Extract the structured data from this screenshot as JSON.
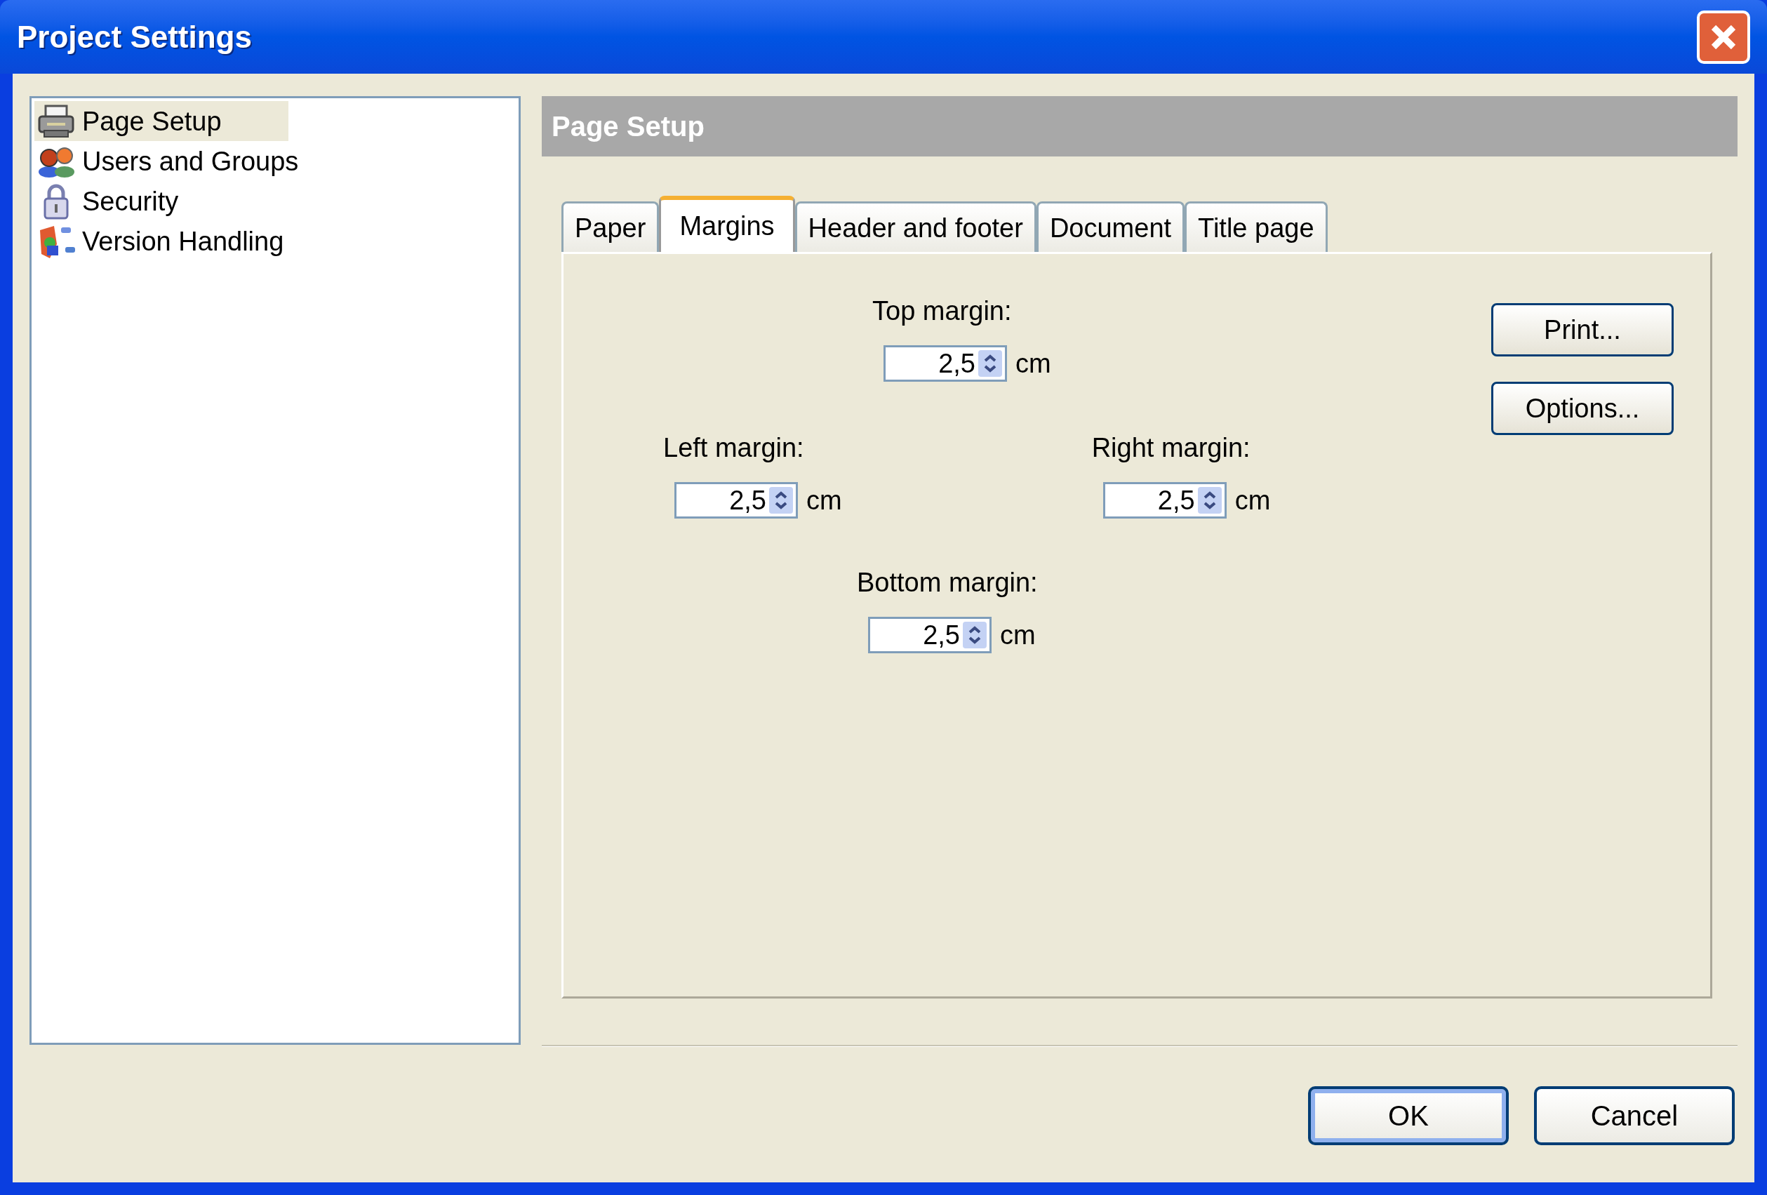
{
  "window": {
    "title": "Project Settings"
  },
  "sidebar": {
    "items": [
      {
        "label": "Page Setup",
        "kind": "printer",
        "selected": true
      },
      {
        "label": "Users and Groups",
        "kind": "users",
        "selected": false
      },
      {
        "label": "Security",
        "kind": "lock",
        "selected": false
      },
      {
        "label": "Version Handling",
        "kind": "version",
        "selected": false
      }
    ]
  },
  "header": "Page Setup",
  "tabs": [
    {
      "label": "Paper",
      "selected": false
    },
    {
      "label": "Margins",
      "selected": true
    },
    {
      "label": "Header and footer",
      "selected": false
    },
    {
      "label": "Document",
      "selected": false
    },
    {
      "label": "Title page",
      "selected": false
    }
  ],
  "margins": {
    "top": {
      "label": "Top margin:",
      "value": "2,5",
      "unit": "cm"
    },
    "left": {
      "label": "Left margin:",
      "value": "2,5",
      "unit": "cm"
    },
    "right": {
      "label": "Right margin:",
      "value": "2,5",
      "unit": "cm"
    },
    "bottom": {
      "label": "Bottom margin:",
      "value": "2,5",
      "unit": "cm"
    }
  },
  "side_buttons": [
    "Print...",
    "Options..."
  ],
  "buttons": [
    {
      "label": "OK",
      "default": true
    },
    {
      "label": "Cancel",
      "default": false
    }
  ]
}
